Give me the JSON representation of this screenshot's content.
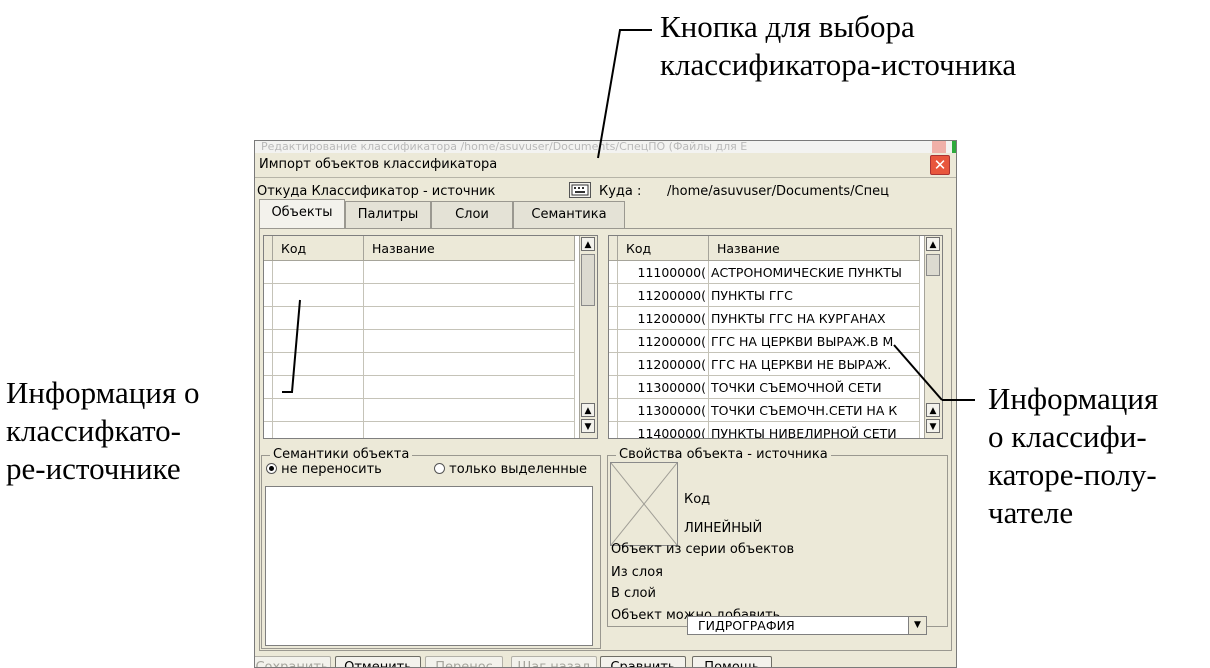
{
  "annotations": {
    "top": [
      "Кнопка для выбора",
      "классификатора-источника"
    ],
    "left": [
      "Информация о",
      "классифкато-",
      "ре-источнике"
    ],
    "right": [
      "Информация",
      "о классифи-",
      "каторе-полу-",
      "чателе"
    ]
  },
  "background_window_title": "Редактирование классификатора /home/asuvuser/Documents/СпецПО (Файлы для Е",
  "dialog": {
    "title": "Импорт объектов классификатора",
    "source_label": "Откуда Классификатор - источник",
    "dest_label": "Куда :",
    "dest_path": "/home/asuvuser/Documents/Спец",
    "tabs": [
      "Объекты",
      "Палитры",
      "Слои",
      "Семантика"
    ],
    "left_table": {
      "columns": [
        "Код",
        "Название"
      ]
    },
    "right_table": {
      "columns": [
        "Код",
        "Название"
      ],
      "rows": [
        [
          "11100000(",
          "АСТРОНОМИЧЕСКИЕ ПУНКТЫ"
        ],
        [
          "11200000(",
          "ПУНКТЫ ГГС"
        ],
        [
          "11200000(",
          "ПУНКТЫ ГГС НА КУРГАНАХ"
        ],
        [
          "11200000(",
          "ГГС НА ЦЕРКВИ ВЫРАЖ.В М"
        ],
        [
          "11200000(",
          "ГГС НА ЦЕРКВИ НЕ ВЫРАЖ."
        ],
        [
          "11300000(",
          "ТОЧКИ СЪЕМОЧНОЙ СЕТИ"
        ],
        [
          "11300000(",
          "ТОЧКИ СЪЕМОЧН.СЕТИ НА К"
        ],
        [
          "11400000(",
          "ПУНКТЫ НИВЕЛИРНОЙ СЕТИ"
        ]
      ]
    },
    "semantics_group": {
      "title": "Семантики объекта",
      "options": [
        "не переносить",
        "только выделенные"
      ],
      "selected": 0
    },
    "props_group": {
      "title": "Свойства объекта - источника",
      "code_label": "Код",
      "type_value": "ЛИНЕЙНЫЙ",
      "series_label": "Объект из серии объектов",
      "from_layer_label": "Из слоя",
      "to_layer_label": "В слой",
      "to_layer_value": "ГИДРОГРАФИЯ",
      "can_add_label": "Объект можно добавить"
    },
    "buttons": [
      {
        "label": "Сохранить",
        "enabled": false
      },
      {
        "label": "Отменить",
        "enabled": true
      },
      {
        "label": "Перенос",
        "enabled": false
      },
      {
        "label": "Шаг назад",
        "enabled": false
      },
      {
        "label": "Сравнить",
        "enabled": true
      },
      {
        "label": "Помощь",
        "enabled": true
      }
    ]
  }
}
